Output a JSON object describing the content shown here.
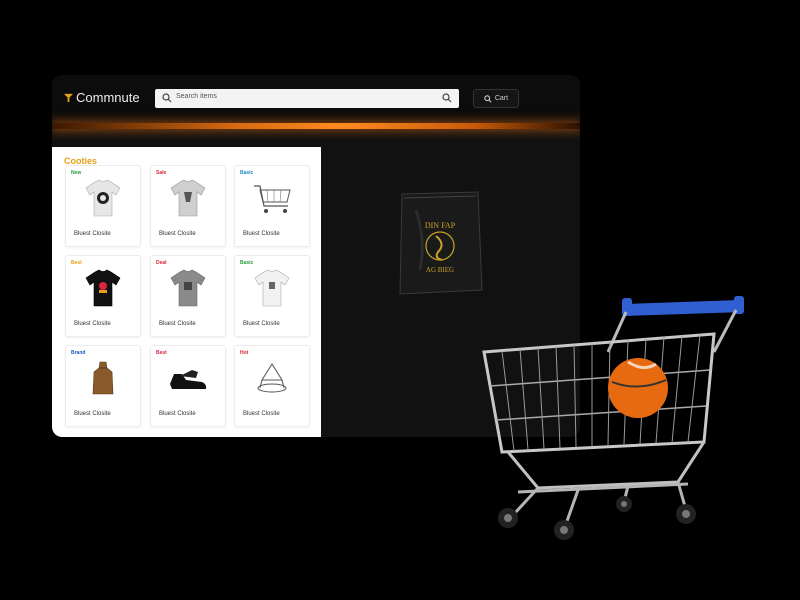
{
  "app": {
    "logo": "Commnute",
    "search_placeholder": "Search items",
    "header_button": "Cart"
  },
  "catalog": {
    "title": "Cooties",
    "products": [
      {
        "tag": "New",
        "tag_color": "#2a9d3a",
        "caption": "Bluest Closite",
        "icon": "tshirt-icon"
      },
      {
        "tag": "Sale",
        "tag_color": "#d9263d",
        "caption": "Bluest Closite",
        "icon": "tshirt-icon"
      },
      {
        "tag": "Basic",
        "tag_color": "#1e8bc3",
        "caption": "Bluest Closite",
        "icon": "cart-icon"
      },
      {
        "tag": "Best",
        "tag_color": "#e8a116",
        "caption": "Bluest Closite",
        "icon": "tshirt-icon"
      },
      {
        "tag": "Deal",
        "tag_color": "#d9263d",
        "caption": "Bluest Closite",
        "icon": "tshirt-icon"
      },
      {
        "tag": "Basic",
        "tag_color": "#2a9d3a",
        "caption": "Bluest Closite",
        "icon": "tshirt-icon"
      },
      {
        "tag": "Brand",
        "tag_color": "#1e5bc3",
        "caption": "Bluest Closite",
        "icon": "bag-icon"
      },
      {
        "tag": "Best",
        "tag_color": "#d9263d",
        "caption": "Bluest Closite",
        "icon": "shoe-icon"
      },
      {
        "tag": "Hot",
        "tag_color": "#d9263d",
        "caption": "Bluest Closite",
        "icon": "hanger-icon"
      }
    ]
  },
  "featured": {
    "bag_text_1": "DIN FAP",
    "bag_text_2": "AG BIEG",
    "icon": "package-bag-icon"
  },
  "colors": {
    "accent": "#e8a116",
    "glow": "#ff8a20",
    "cart_handle": "#2f5fd0"
  }
}
